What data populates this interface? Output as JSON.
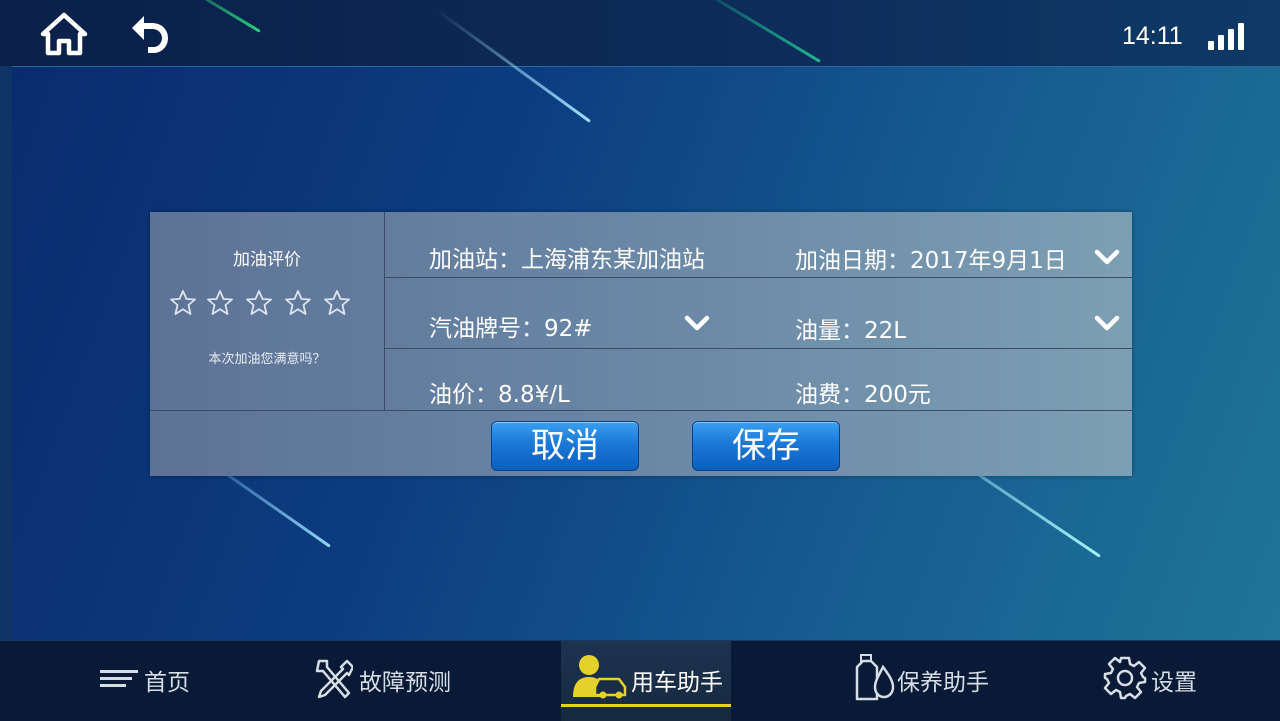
{
  "header": {
    "time": "14:11",
    "icons": {
      "home": "home-icon",
      "back": "back-arrow-icon",
      "signal": "signal-strength-icon"
    }
  },
  "dialog": {
    "rating": {
      "title": "加油评价",
      "stars_total": 5,
      "stars_selected": 0,
      "question": "本次加油您满意吗？"
    },
    "fields": {
      "station": "加油站：上海浦东某加油站",
      "date": "加油日期：2017年9月1日",
      "gas_grade": "汽油牌号：92#",
      "volume": "油量：22L",
      "price": "油价：8.8¥/L",
      "cost": "油费：200元"
    },
    "buttons": {
      "cancel": "取消",
      "save": "保存"
    }
  },
  "nav": {
    "items": [
      {
        "label": "首页",
        "icon": "menu-lines-icon"
      },
      {
        "label": "故障预测",
        "icon": "tools-icon"
      },
      {
        "label": "用车助手",
        "icon": "driver-car-icon",
        "active": true
      },
      {
        "label": "保养助手",
        "icon": "oil-bottle-icon"
      },
      {
        "label": "设置",
        "icon": "gear-icon"
      }
    ]
  },
  "colors": {
    "accent_active": "#e4d12a",
    "button_blue": "#1a78d8",
    "panel": "#6a87a6"
  }
}
